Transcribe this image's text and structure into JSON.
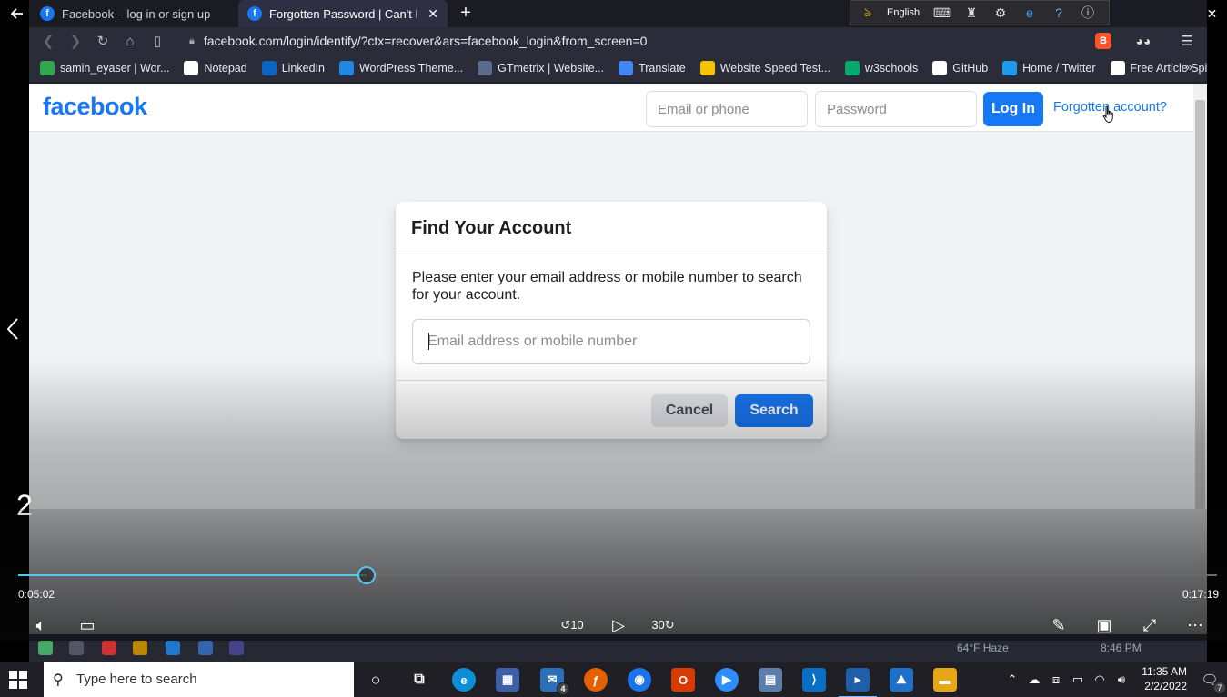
{
  "browser": {
    "tabs": [
      {
        "title": "Facebook – log in or sign up",
        "active": false
      },
      {
        "title": "Forgotten Password | Can't Log In",
        "active": true
      }
    ],
    "language_bar": {
      "language": "English"
    },
    "url": "facebook.com/login/identify/?ctx=recover&ars=facebook_login&from_screen=0",
    "bookmarks": [
      {
        "label": "samin_eyaser | Wor...",
        "icon": "wordpress-icon",
        "color": "#2fa84f"
      },
      {
        "label": "Notepad",
        "icon": "notepad-icon",
        "color": "#ffffff"
      },
      {
        "label": "LinkedIn",
        "icon": "linkedin-icon",
        "color": "#0a66c2"
      },
      {
        "label": "WordPress Theme...",
        "icon": "td-icon",
        "color": "#1e88e5"
      },
      {
        "label": "GTmetrix | Website...",
        "icon": "gtmetrix-icon",
        "color": "#5b6b8c"
      },
      {
        "label": "Translate",
        "icon": "translate-icon",
        "color": "#4285f4"
      },
      {
        "label": "Website Speed Test...",
        "icon": "pingdom-icon",
        "color": "#f5c400"
      },
      {
        "label": "w3schools",
        "icon": "w3schools-icon",
        "color": "#04aa6d"
      },
      {
        "label": "GitHub",
        "icon": "github-icon",
        "color": "#ffffff"
      },
      {
        "label": "Home / Twitter",
        "icon": "twitter-icon",
        "color": "#1d9bf0"
      },
      {
        "label": "Free Article Spinner...",
        "icon": "spinner-icon",
        "color": "#ffffff"
      }
    ]
  },
  "page": {
    "logo": "facebook",
    "header": {
      "email_placeholder": "Email or phone",
      "password_placeholder": "Password",
      "login_label": "Log In",
      "forgot_label": "Forgotten account?"
    },
    "card": {
      "title": "Find Your Account",
      "description": "Please enter your email address or mobile number to search for your account.",
      "input_placeholder": "Email address or mobile number",
      "cancel_label": "Cancel",
      "search_label": "Search"
    },
    "colors": {
      "brand": "#1877f2",
      "background": "#f0f2f5"
    }
  },
  "player": {
    "chapter": "2",
    "current_time": "0:05:02",
    "total_time": "0:17:19",
    "progress": 0.2905
  },
  "inner_taskbar": {
    "weather": "64°F  Haze",
    "time": "8:46 PM"
  },
  "taskbar": {
    "search_placeholder": "Type here to search",
    "mail_badge": "4",
    "notification_count": "7",
    "time": "11:35 AM",
    "date": "2/2/2022"
  }
}
